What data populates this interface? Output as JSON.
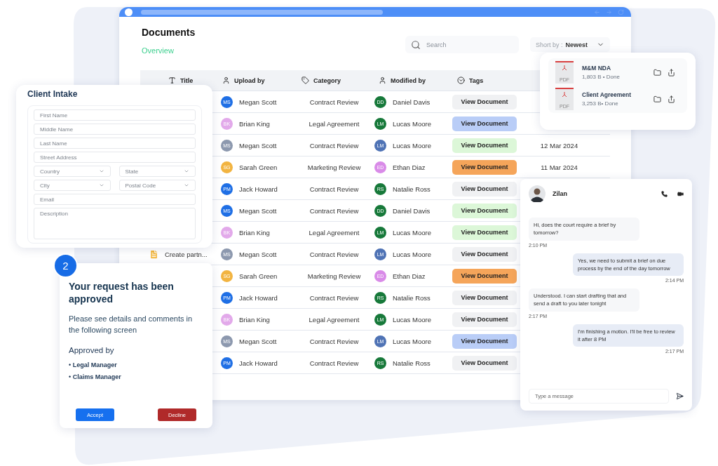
{
  "documents": {
    "title": "Documents",
    "tab": "Overview",
    "search": {
      "placeholder": "Search"
    },
    "sort": {
      "label": "Short by :",
      "value": "Newest"
    },
    "columns": [
      "Title",
      "Upload by",
      "Category",
      "Modified by",
      "Tags"
    ],
    "rows": [
      {
        "uploader": {
          "initials": "MS",
          "name": "Megan Scott",
          "color": "#1f6fe5"
        },
        "category": "Contract Review",
        "modifier": {
          "initials": "DD",
          "name": "Daniel Davis",
          "color": "#17793a"
        },
        "tag": {
          "label": "View Document",
          "color": "#f0f1f3"
        }
      },
      {
        "uploader": {
          "initials": "BK",
          "name": "Brian King",
          "color": "#e2a9ea"
        },
        "category": "Legal Agreement",
        "modifier": {
          "initials": "LM",
          "name": "Lucas Moore",
          "color": "#17793a"
        },
        "tag": {
          "label": "View Document",
          "color": "#b9cdf7"
        }
      },
      {
        "uploader": {
          "initials": "MS",
          "name": "Megan Scott",
          "color": "#8c98ae"
        },
        "category": "Contract Review",
        "modifier": {
          "initials": "LM",
          "name": "Lucas Moore",
          "color": "#4f73b5"
        },
        "tag": {
          "label": "View Document",
          "color": "#dcf7d8"
        },
        "date": "12 Mar 2024"
      },
      {
        "uploader": {
          "initials": "SG",
          "name": "Sarah Green",
          "color": "#f2b441"
        },
        "category": "Marketing Review",
        "modifier": {
          "initials": "ED",
          "name": "Ethan Diaz",
          "color": "#d98be8"
        },
        "tag": {
          "label": "View Document",
          "color": "#f5a55a"
        },
        "date": "11 Mar 2024"
      },
      {
        "uploader": {
          "initials": "PM",
          "name": "Jack Howard",
          "color": "#1f6fe5"
        },
        "category": "Contract Review",
        "modifier": {
          "initials": "RS",
          "name": "Natalie Ross",
          "color": "#17793a"
        },
        "tag": {
          "label": "View Document",
          "color": "#f0f1f3"
        }
      },
      {
        "uploader": {
          "initials": "MS",
          "name": "Megan Scott",
          "color": "#1f6fe5"
        },
        "category": "Contract Review",
        "modifier": {
          "initials": "DD",
          "name": "Daniel Davis",
          "color": "#17793a"
        },
        "tag": {
          "label": "View Document",
          "color": "#dcf7d8"
        }
      },
      {
        "uploader": {
          "initials": "BK",
          "name": "Brian King",
          "color": "#e2a9ea"
        },
        "category": "Legal Agreement",
        "modifier": {
          "initials": "LM",
          "name": "Lucas Moore",
          "color": "#17793a"
        },
        "tag": {
          "label": "View Document",
          "color": "#dcf7d8"
        }
      },
      {
        "title": "Create partn...",
        "uploader": {
          "initials": "MS",
          "name": "Megan Scott",
          "color": "#8c98ae"
        },
        "category": "Contract Review",
        "modifier": {
          "initials": "LM",
          "name": "Lucas Moore",
          "color": "#4f73b5"
        },
        "tag": {
          "label": "View Document",
          "color": "#f0f1f3"
        }
      },
      {
        "uploader": {
          "initials": "SG",
          "name": "Sarah Green",
          "color": "#f2b441"
        },
        "category": "Marketing Review",
        "modifier": {
          "initials": "ED",
          "name": "Ethan Diaz",
          "color": "#d98be8"
        },
        "tag": {
          "label": "View Document",
          "color": "#f5a55a"
        }
      },
      {
        "uploader": {
          "initials": "PM",
          "name": "Jack Howard",
          "color": "#1f6fe5"
        },
        "category": "Contract Review",
        "modifier": {
          "initials": "RS",
          "name": "Natalie Ross",
          "color": "#17793a"
        },
        "tag": {
          "label": "View Document",
          "color": "#f0f1f3"
        }
      },
      {
        "uploader": {
          "initials": "BK",
          "name": "Brian King",
          "color": "#e2a9ea"
        },
        "category": "Legal Agreement",
        "modifier": {
          "initials": "LM",
          "name": "Lucas Moore",
          "color": "#17793a"
        },
        "tag": {
          "label": "View Document",
          "color": "#f0f1f3"
        }
      },
      {
        "uploader": {
          "initials": "MS",
          "name": "Megan Scott",
          "color": "#8c98ae"
        },
        "category": "Contract Review",
        "modifier": {
          "initials": "LM",
          "name": "Lucas Moore",
          "color": "#4f73b5"
        },
        "tag": {
          "label": "View Document",
          "color": "#b9cdf7"
        }
      },
      {
        "uploader": {
          "initials": "PM",
          "name": "Jack Howard",
          "color": "#1f6fe5"
        },
        "category": "Contract Review",
        "modifier": {
          "initials": "RS",
          "name": "Natalie Ross",
          "color": "#17793a"
        },
        "tag": {
          "label": "View Document",
          "color": "#f0f1f3"
        }
      }
    ]
  },
  "intake": {
    "title": "Client Intake",
    "fields": [
      {
        "kind": "text",
        "placeholder": "First Name"
      },
      {
        "kind": "text",
        "placeholder": "Middle Name"
      },
      {
        "kind": "text",
        "placeholder": "Last Name"
      },
      {
        "kind": "text",
        "placeholder": "Street Address"
      },
      {
        "kind": "select",
        "placeholder": "Country"
      },
      {
        "kind": "select",
        "placeholder": "State"
      },
      {
        "kind": "select",
        "placeholder": "City"
      },
      {
        "kind": "select",
        "placeholder": "Postal Code"
      },
      {
        "kind": "text",
        "placeholder": "Email"
      },
      {
        "kind": "textarea",
        "placeholder": "Description"
      }
    ]
  },
  "approval": {
    "step": "2",
    "title": "Your request has been approved",
    "message": "Please see details and comments in the following screen",
    "approved_by": "Approved by",
    "approvers": [
      "• Legal Manager",
      "• Claims Manager"
    ],
    "buttons": [
      {
        "label": "Accept",
        "kind": "accept"
      },
      {
        "label": "Decline",
        "kind": "decline"
      }
    ]
  },
  "files": [
    {
      "badge": "PDF",
      "name": "M&M NDA",
      "meta": "1,803 B • Done"
    },
    {
      "badge": "PDF",
      "name": "Client Agreement",
      "meta": "3,253 B• Done"
    }
  ],
  "chat": {
    "contact": "Zilan",
    "messages": [
      {
        "kind": "incoming",
        "text": "Hi, does the court require a brief by tomorrow?",
        "time": "2:10 PM"
      },
      {
        "kind": "outgoing",
        "text": "Yes, we need to submit a brief on due process by the end of the day tomorrow",
        "time": "2:14 PM"
      },
      {
        "kind": "incoming",
        "text": "Understood. I can start drafting that and send a draft to you later tonight",
        "time": "2:17 PM"
      },
      {
        "kind": "outgoing",
        "text": "I'm finishing a motion. I'll be free to review it after 8 PM",
        "time": "2:17 PM"
      }
    ],
    "input": {
      "placeholder": "Type a message"
    }
  }
}
